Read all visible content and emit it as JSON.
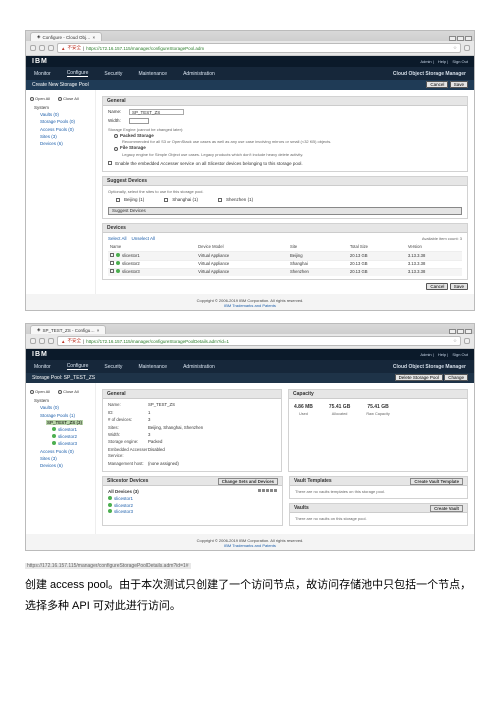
{
  "browser1": {
    "tab_title": "Configure - Cloud Obj…",
    "security_text": "不安全",
    "url": "https://172.16.157.115/manager/configureStoragePool.adm"
  },
  "browser2": {
    "tab_title": "SP_TEST_ZS - Configu…",
    "security_text": "不安全",
    "url": "https://172.16.157.115/manager/configureStoragePoolDetails.adm?id=1"
  },
  "ibm": {
    "logo": "IBM",
    "top_links": [
      "Admin",
      "Help",
      "Sign Out"
    ],
    "nav": [
      "Monitor",
      "Configure",
      "Security",
      "Maintenance",
      "Administration"
    ],
    "product": "Cloud Object Storage Manager"
  },
  "bar1_title": "Create New Storage Pool",
  "bar1_btns": [
    "Cancel",
    "Save"
  ],
  "sidebar1": {
    "open_all": "Open All",
    "close_all": "Close All",
    "tree": [
      "System",
      "Vaults (0)",
      "Storage Pools (0)",
      "Access Pools (0)",
      "Sites (3)",
      "Devices (6)"
    ]
  },
  "form": {
    "name_label": "Name:",
    "name_value": "SP_TEST_ZS",
    "width_label": "Width:",
    "engine_note": "Storage Engine (cannot be changed later):",
    "engine_opt1": "Packed Storage",
    "engine_opt1_desc": "Recommended for all S3 or OpenStack use cases as well as any use case involving mirrors or small (<32 KB) objects.",
    "engine_opt2": "File Storage",
    "engine_opt2_desc": "Legacy engine for Simple Object use cases. Legacy products which don't include heavy delete activity.",
    "embed_label": "Enable the embedded Accesser service on all Slicestor devices belonging to this storage pool."
  },
  "suggest_panel": {
    "title": "Suggest Devices",
    "note": "Optionally, select the sites to use for this storage pool.",
    "sites": [
      "Beijing (1)",
      "Shanghai (1)",
      "Shenzhen (1)"
    ],
    "btn": "Suggest Devices"
  },
  "devices_panel": {
    "title": "Devices",
    "select_all": "Select All",
    "unselect_all": "Unselect All",
    "right_note": "Available item count: 3",
    "cols": [
      "Name",
      "Device Model",
      "Site",
      "Total Size",
      "Version"
    ],
    "rows": [
      {
        "name": "slicestor1",
        "model": "Virtual Appliance",
        "site": "Beijing",
        "size": "20.13 GB",
        "ver": "3.13.3.38"
      },
      {
        "name": "slicestor2",
        "model": "Virtual Appliance",
        "site": "Shanghai",
        "size": "20.13 GB",
        "ver": "3.13.3.38"
      },
      {
        "name": "slicestor3",
        "model": "Virtual Appliance",
        "site": "Shenzhen",
        "size": "20.13 GB",
        "ver": "3.13.3.38"
      }
    ]
  },
  "footer": {
    "copyright": "Copyright © 2006-2019 IBM Corporation. All rights reserved.",
    "link": "IBM Trademarks and Patents"
  },
  "bar2_title": "Storage Pool: SP_TEST_ZS",
  "bar2_btns": [
    "Delete Storage Pool",
    "Change"
  ],
  "sidebar2": {
    "tree_root": "System",
    "vaults": "Vaults (0)",
    "sp": "Storage Pools (1)",
    "sp_sel": "SP_TEST_ZS (3)",
    "sp_kids": [
      "slicestor1",
      "slicestor2",
      "slicestor3"
    ],
    "ap": "Access Pools (0)",
    "sites": "Sites (3)",
    "devices": "Devices (6)"
  },
  "general2": {
    "title": "General",
    "rows": [
      [
        "Name:",
        "SP_TEST_ZS"
      ],
      [
        "ID:",
        "1"
      ],
      [
        "# of devices:",
        "3"
      ],
      [
        "Sites:",
        "Beijing, Shanghai, Shenzhen"
      ],
      [
        "Width:",
        "3"
      ],
      [
        "Storage engine:",
        "Packed"
      ],
      [
        "Embedded Accesser Service:",
        "Disabled"
      ],
      [
        "Management host:",
        "(none assigned)"
      ]
    ]
  },
  "capacity": {
    "title": "Capacity",
    "vals": [
      {
        "n": "4.86 MB",
        "u": "Used"
      },
      {
        "n": "75.41 GB",
        "u": "Allocated"
      },
      {
        "n": "75.41 GB",
        "u": "Raw Capacity"
      }
    ]
  },
  "slicestor_panel": {
    "title": "Slicestor Devices",
    "btn": "Change Sets and Devices",
    "all_label": "All Devices (3)",
    "rows": [
      "slicestor1",
      "slicestor2",
      "slicestor3"
    ]
  },
  "vault_templates": {
    "title": "Vault Templates",
    "btn": "Create Vault Template",
    "msg": "There are no vaults templates on this storage pool."
  },
  "vaults": {
    "title": "Vaults",
    "btn": "Create Vault",
    "msg": "There are no vaults on this storage pool."
  },
  "url_caption": "https://172.16.157.115/manager/configureStoragePoolDetails.adm?id=1#",
  "paragraph": "创建 access pool。由于本次测试只创建了一个访问节点，故访问存储池中只包括一个节点，选择多种 API 可对此进行访问。"
}
